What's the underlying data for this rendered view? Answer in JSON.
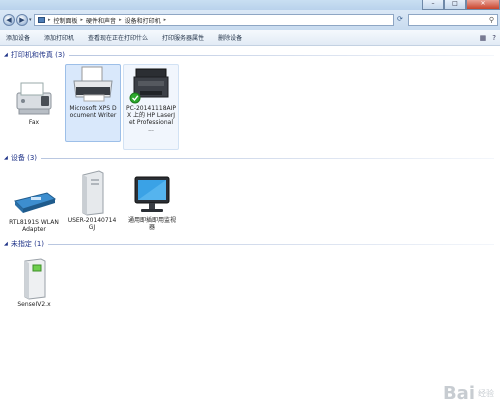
{
  "window": {
    "title": "",
    "buttons": {
      "minimize": "–",
      "maximize": "□",
      "close": "✕"
    }
  },
  "address": {
    "crumbs": [
      "控制面板",
      "硬件和声音",
      "设备和打印机"
    ],
    "separator": "▸",
    "search_placeholder": ""
  },
  "toolbar": {
    "items": [
      "添加设备",
      "添加打印机",
      "查看现在正在打印什么",
      "打印服务器属性",
      "删除设备"
    ]
  },
  "groups": {
    "printers": {
      "title": "打印机和传真 (3)",
      "items": [
        {
          "label": "Fax",
          "icon": "fax-icon"
        },
        {
          "label": "Microsoft XPS Document Writer",
          "icon": "printer-icon",
          "selected": true
        },
        {
          "label": "PC-20141118AIPX 上的 HP LaserJet Professional ...",
          "icon": "multifunction-printer-icon",
          "default": true
        }
      ]
    },
    "devices": {
      "title": "设备 (3)",
      "items": [
        {
          "label": "RTL8191S WLAN Adapter",
          "icon": "wlan-adapter-icon"
        },
        {
          "label": "USER-20140714GJ",
          "icon": "computer-tower-icon"
        },
        {
          "label": "通用即插即用监视器",
          "icon": "monitor-icon"
        }
      ]
    },
    "unspecified": {
      "title": "未指定 (1)",
      "items": [
        {
          "label": "SenseIV2.x",
          "icon": "device-box-icon"
        }
      ]
    }
  },
  "watermark": {
    "brand": "Bai",
    "suffix": "经验"
  }
}
